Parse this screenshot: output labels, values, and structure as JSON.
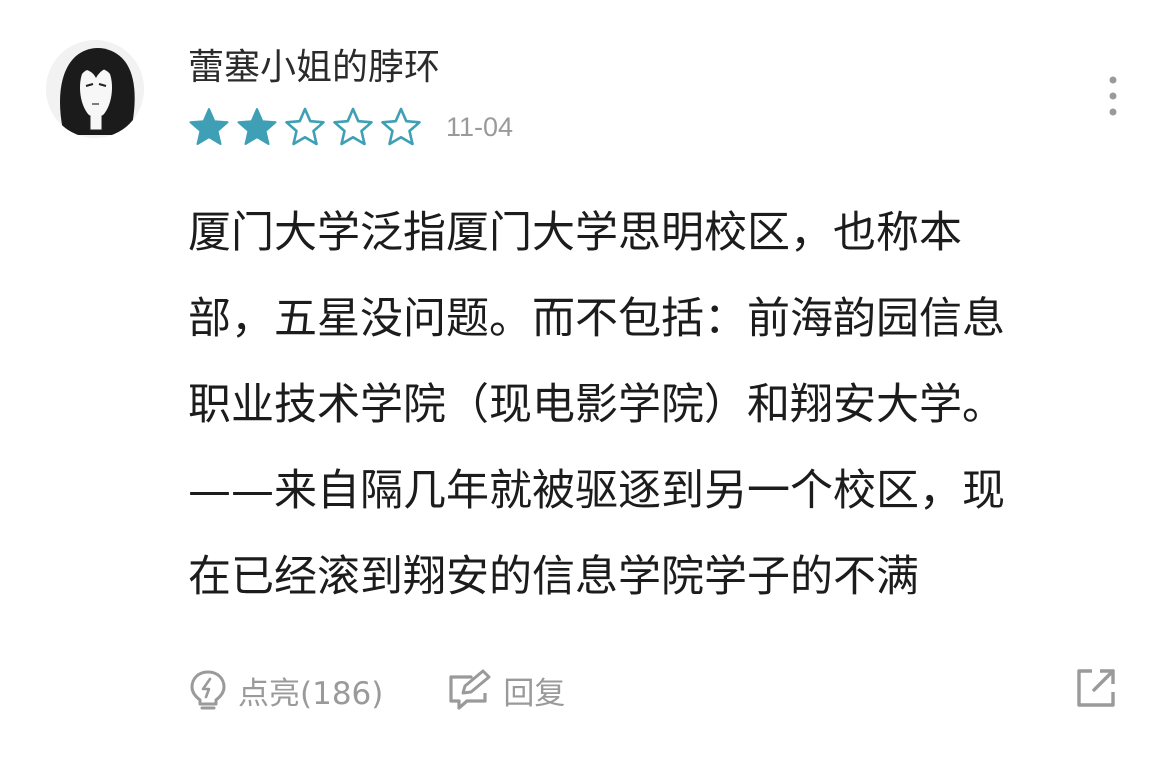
{
  "comment": {
    "username": "蕾塞小姐的脖环",
    "rating": 2,
    "rating_max": 5,
    "date": "11-04",
    "lines": [
      "厦门大学泛指厦门大学思明校区，也称本",
      "部，五星没问题。而不包括：前海韵园信息",
      "职业技术学院（现电影学院）和翔安大学。",
      "——来自隔几年就被驱逐到另一个校区，现",
      "在已经滚到翔安的信息学院学子的不满"
    ]
  },
  "actions": {
    "like_label": "点亮(186)",
    "reply_label": "回复"
  },
  "icons": {
    "avatar": "avatar-portrait",
    "more": "more-vertical-icon",
    "star_filled": "star-filled-icon",
    "star_empty": "star-outline-icon",
    "like": "lightbulb-icon",
    "reply": "edit-reply-icon",
    "share": "share-external-icon"
  },
  "colors": {
    "star_filled": "#3e9fb5",
    "star_empty": "#3e9fb5",
    "muted": "#9a9a9a"
  }
}
